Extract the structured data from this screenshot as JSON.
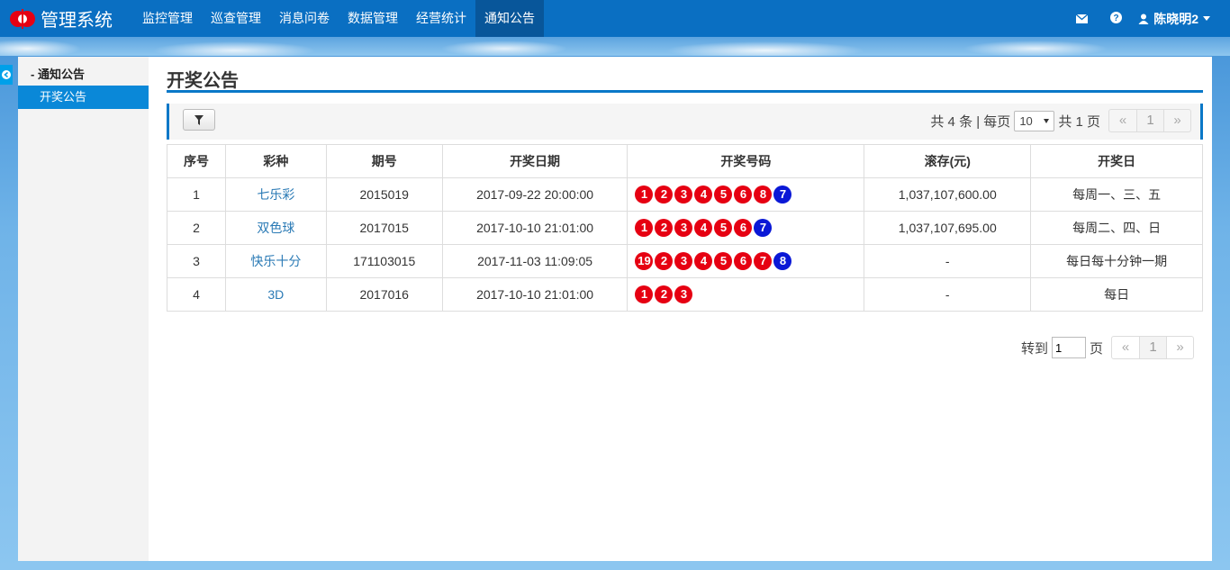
{
  "header": {
    "title": "管理系统",
    "nav": [
      "监控管理",
      "巡查管理",
      "消息问卷",
      "数据管理",
      "经营统计",
      "通知公告"
    ],
    "active_nav": "通知公告",
    "user_name": "陈晓明2",
    "icons": [
      "mail-icon",
      "help-icon",
      "user-icon"
    ]
  },
  "sidebar": {
    "group_label": "- 通知公告",
    "items": [
      {
        "label": "开奖公告",
        "active": true
      }
    ]
  },
  "main": {
    "page_title": "开奖公告",
    "pager_top": {
      "total_text": "共 4 条 | 每页",
      "page_size": "10",
      "pages_text": "共 1 页",
      "prev": "«",
      "current": "1",
      "next": "»"
    },
    "table": {
      "headers": [
        "序号",
        "彩种",
        "期号",
        "开奖日期",
        "开奖号码",
        "滚存(元)",
        "开奖日"
      ],
      "rows": [
        {
          "no": "1",
          "game": "七乐彩",
          "issue": "2015019",
          "date": "2017-09-22 20:00:00",
          "red": [
            "1",
            "2",
            "3",
            "4",
            "5",
            "6",
            "8"
          ],
          "blue": [
            "7"
          ],
          "pool": "1,037,107,600.00",
          "day": "每周一、三、五"
        },
        {
          "no": "2",
          "game": "双色球",
          "issue": "2017015",
          "date": "2017-10-10 21:01:00",
          "red": [
            "1",
            "2",
            "3",
            "4",
            "5",
            "6"
          ],
          "blue": [
            "7"
          ],
          "pool": "1,037,107,695.00",
          "day": "每周二、四、日"
        },
        {
          "no": "3",
          "game": "快乐十分",
          "issue": "171103015",
          "date": "2017-11-03 11:09:05",
          "red": [
            "19",
            "2",
            "3",
            "4",
            "5",
            "6",
            "7"
          ],
          "blue": [
            "8"
          ],
          "pool": "-",
          "day": "每日每十分钟一期"
        },
        {
          "no": "4",
          "game": "3D",
          "issue": "2017016",
          "date": "2017-10-10 21:01:00",
          "red": [
            "1",
            "2",
            "3"
          ],
          "blue": [],
          "pool": "-",
          "day": "每日"
        }
      ]
    },
    "pager_bottom": {
      "goto_label": "转到",
      "goto_value": "1",
      "page_label": "页",
      "prev": "«",
      "current": "1",
      "next": "»"
    }
  },
  "colors": {
    "nav_bg": "#0a6fc2",
    "accent": "#0a78c8",
    "red_ball": "#e60012",
    "blue_ball": "#0a18d6"
  }
}
